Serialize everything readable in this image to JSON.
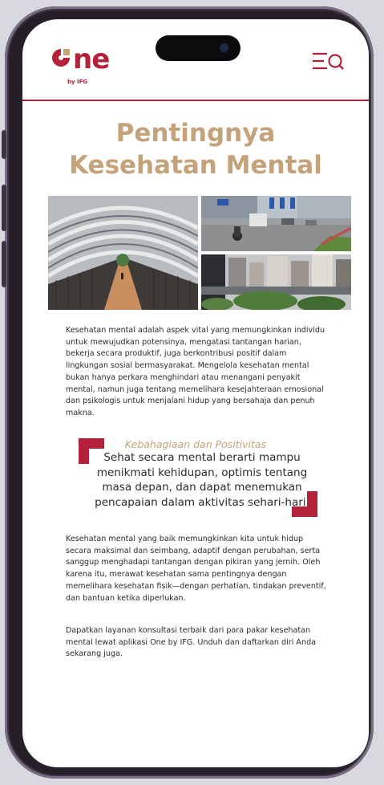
{
  "app": {
    "logo_text": "ne",
    "logo_sub": "by IFG",
    "menu_icon": "menu-search-icon",
    "brand_color": "#b4213a",
    "accent_color": "#c4a27a"
  },
  "article": {
    "title_line1": "Pentingnya",
    "title_line2": "Kesehatan Mental",
    "paragraph1": "Kesehatan mental adalah aspek vital yang memungkinkan individu untuk mewujudkan potensinya, mengatasi tantangan harian, bekerja secara produktif, juga berkontribusi positif dalam lingkungan sosial bermasyarakat. Mengelola kesehatan mental bukan hanya perkara menghindari atau menangani penyakit mental, namun juga tentang memelihara kesejahteraan emosional dan psikologis untuk menjalani hidup yang bersahaja dan penuh makna.",
    "quote_heading": "Kebahagiaan dan Positivitas",
    "quote_text": "Sehat secara mental berarti mampu menikmati kehidupan, optimis tentang masa depan, dan dapat menemukan pencapaian dalam aktivitas sehari-hari.",
    "paragraph2": "Kesehatan mental yang baik memungkinkan kita untuk hidup secara maksimal dan seimbang, adaptif dengan perubahan, serta sanggup menghadapi tantangan dengan pikiran yang jernih. Oleh karena itu, merawat kesehatan sama pentingnya dengan memelihara kesehatan fisik—dengan perhatian, tindakan preventif, dan bantuan ketika diperlukan.",
    "paragraph3": "Dapatkan layanan konsultasi terbaik dari para pakar kesehatan mental lewat aplikasi One by IFG. Unduh dan daftarkan diri Anda sekarang juga."
  }
}
